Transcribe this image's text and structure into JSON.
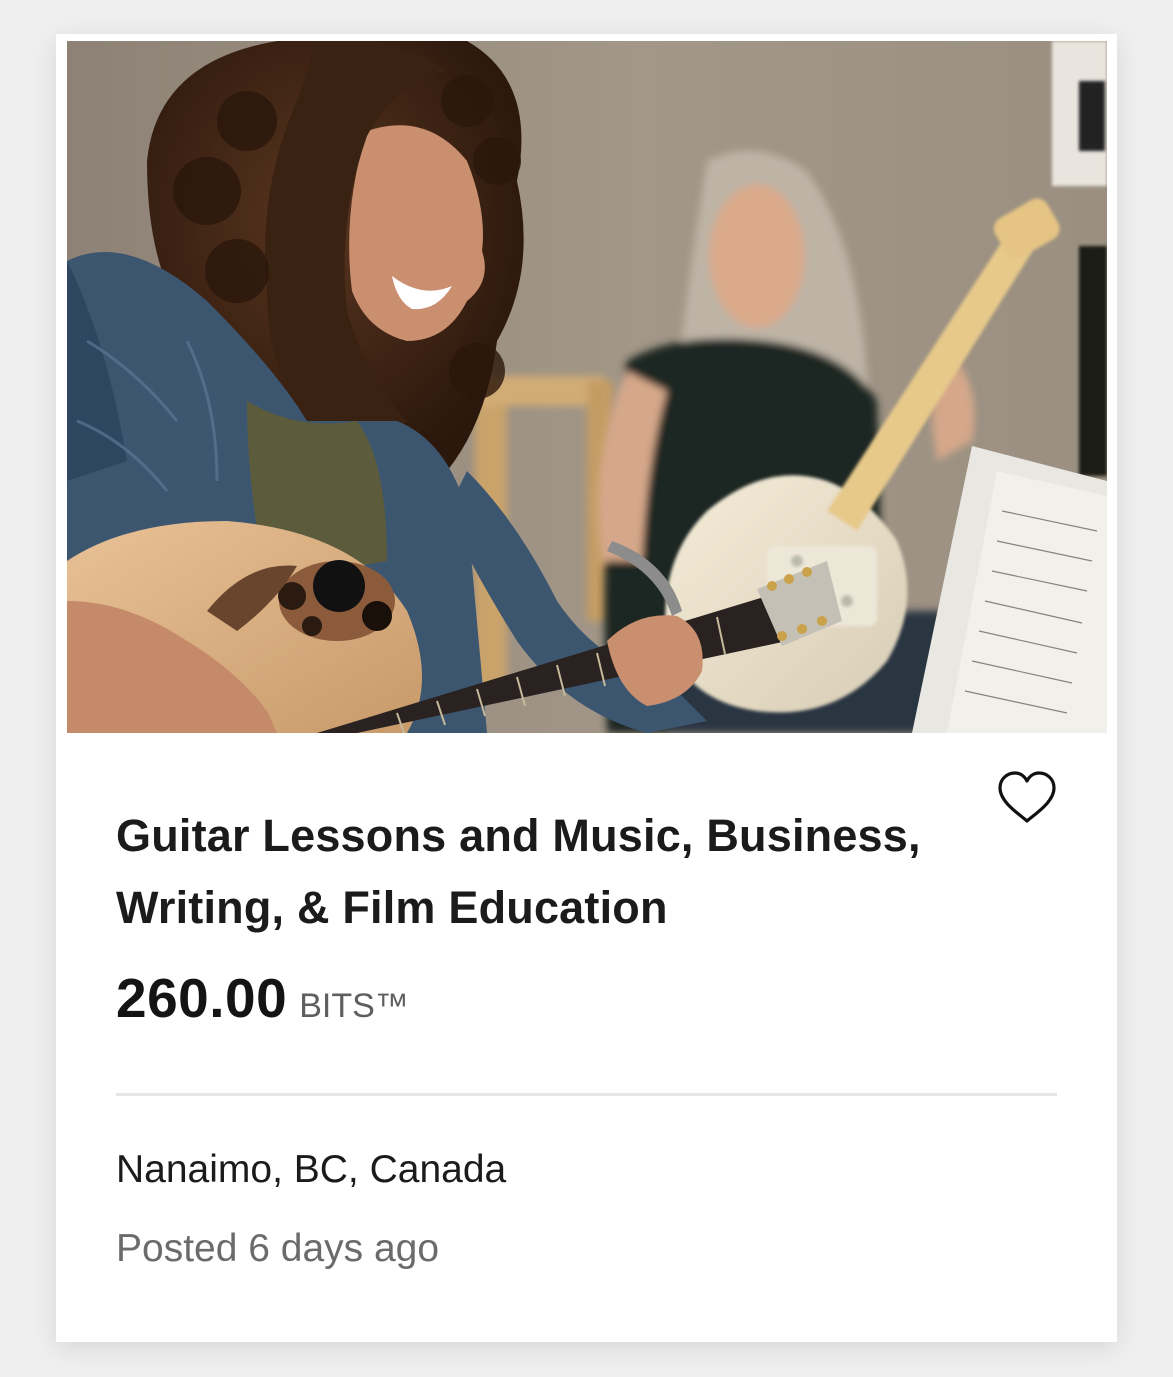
{
  "listing": {
    "image_alt": "Two women playing guitars together",
    "title": "Guitar Lessons and Music, Business, Writing, & Film Education",
    "price": "260.00",
    "currency": "BITS™",
    "location": "Nanaimo, BC, Canada",
    "posted": "Posted 6 days ago",
    "favorite_icon": "heart-outline-icon"
  },
  "colors": {
    "title": "#1b1b1b",
    "muted": "#6b6b6b",
    "divider": "#e6e6e6",
    "card_background": "#ffffff",
    "page_background": "#efefef"
  }
}
